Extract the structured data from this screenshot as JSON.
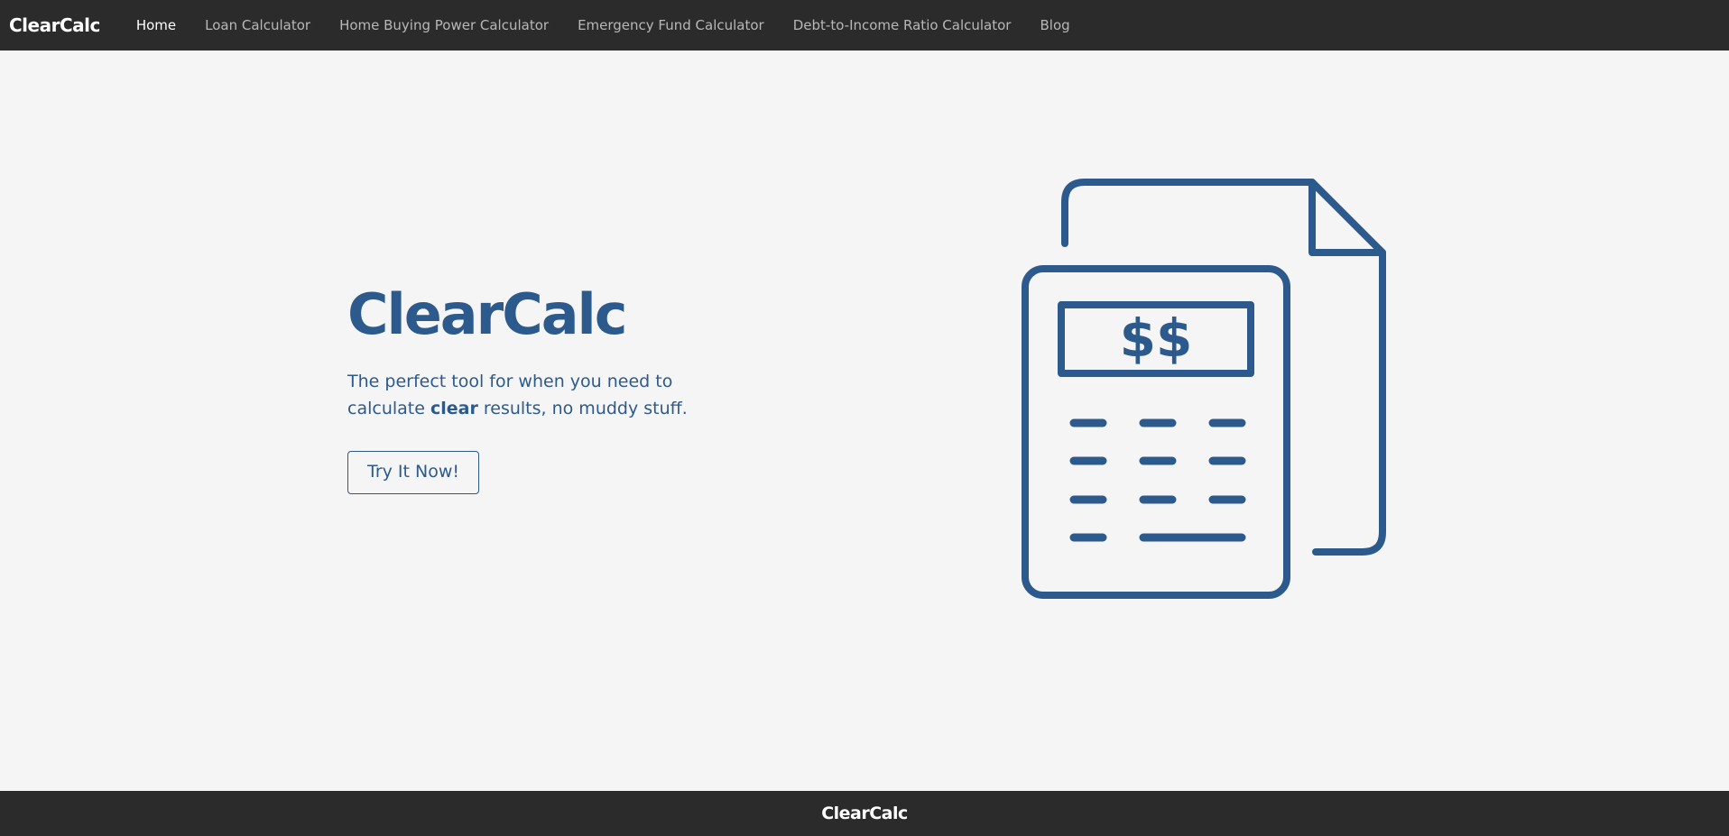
{
  "brand": {
    "name": "ClearCalc",
    "color": "#2d5a8c"
  },
  "nav": {
    "logo": "ClearCalc",
    "items": [
      {
        "label": "Home",
        "active": true
      },
      {
        "label": "Loan Calculator",
        "active": false
      },
      {
        "label": "Home Buying Power Calculator",
        "active": false
      },
      {
        "label": "Emergency Fund Calculator",
        "active": false
      },
      {
        "label": "Debt-to-Income Ratio Calculator",
        "active": false
      },
      {
        "label": "Blog",
        "active": false
      }
    ]
  },
  "hero": {
    "logo": "ClearCalc",
    "tagline_before": "The perfect tool for when you need to calculate ",
    "tagline_bold": "clear",
    "tagline_after": " results, no muddy stuff.",
    "cta_label": "Try It Now!",
    "illustration": {
      "icon": "calculator-document-icon",
      "display_text": "$$"
    }
  },
  "footer": {
    "logo": "ClearCalc"
  }
}
